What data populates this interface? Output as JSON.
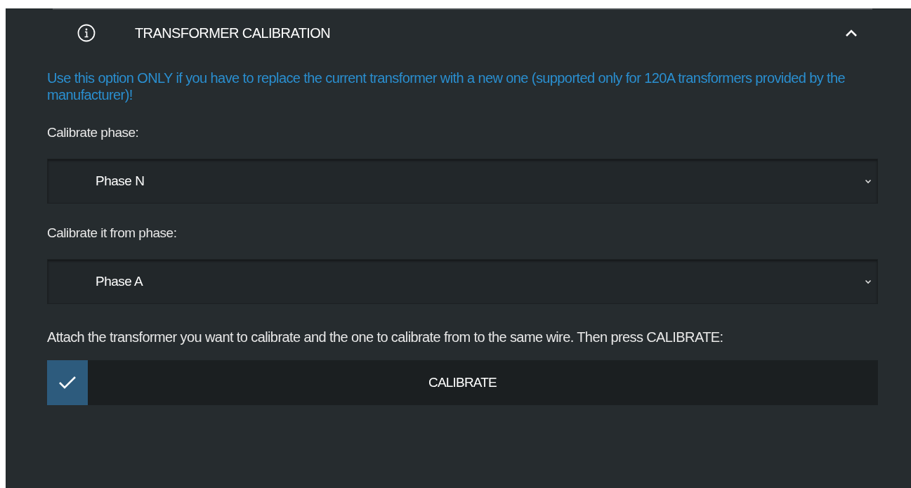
{
  "section": {
    "title": "TRANSFORMER CALIBRATION",
    "expanded": true,
    "notice": "Use this option ONLY if you have to replace the current transformer with a new one (supported only for 120A transformers provided by the manufacturer)!",
    "fields": [
      {
        "label": "Calibrate phase:",
        "value": "Phase N"
      },
      {
        "label": "Calibrate it from phase:",
        "value": "Phase A"
      }
    ],
    "instruction": "Attach the transformer you want to calibrate and the one to calibrate from to the same wire. Then press CALIBRATE:",
    "button": {
      "label": "CALIBRATE"
    }
  }
}
